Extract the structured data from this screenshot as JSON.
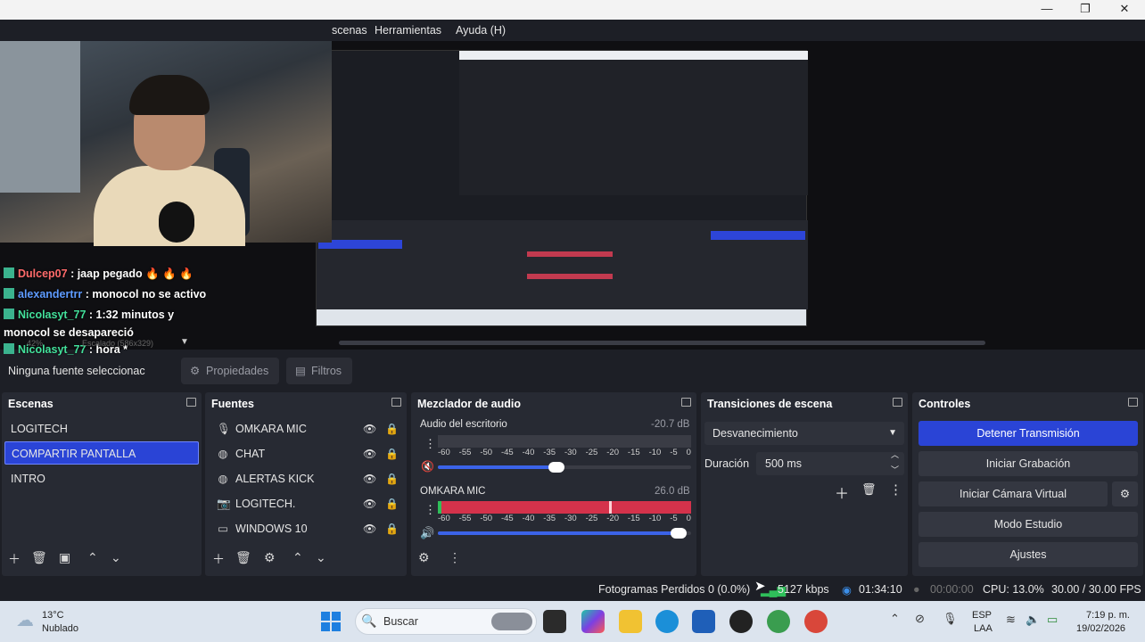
{
  "window": {
    "minimize": "—",
    "maximize": "❐",
    "close": "✕"
  },
  "menu": [
    "scenas",
    "Herramientas",
    "Ayuda (H)"
  ],
  "chat": [
    {
      "user": "Dulcep07",
      "text": ": jaap pegado 🔥 🔥 🔥"
    },
    {
      "user": "alexandertrr",
      "text": ": monocol no se activo"
    },
    {
      "user": "Nicolasyt_77",
      "text": ": 1:32 minutos y"
    },
    {
      "user": "",
      "text": "monocol se desapareció"
    },
    {
      "user": "Nicolasyt_77",
      "text": ": hora *"
    }
  ],
  "preview_overlay": {
    "zoom": "42%",
    "scale": "Escalado (586x329)"
  },
  "sourcebar": {
    "no_source": "Ninguna fuente seleccionac",
    "properties": "Propiedades",
    "filters": "Filtros"
  },
  "scenes": {
    "title": "Escenas",
    "items": [
      "LOGITECH",
      "COMPARTIR PANTALLA",
      "INTRO"
    ],
    "selected": "COMPARTIR PANTALLA"
  },
  "sources": {
    "title": "Fuentes",
    "items": [
      {
        "label": "OMKARA MIC",
        "icon": "microphone-icon"
      },
      {
        "label": "CHAT",
        "icon": "browser-icon"
      },
      {
        "label": "ALERTAS KICK",
        "icon": "browser-icon"
      },
      {
        "label": "LOGITECH.",
        "icon": "camera-icon"
      },
      {
        "label": "WINDOWS 10",
        "icon": "monitor-icon"
      }
    ]
  },
  "mixer": {
    "title": "Mezclador de audio",
    "channels": [
      {
        "name": "Audio del escritorio",
        "db": "-20.7 dB",
        "volume": 0.47,
        "muted": true
      },
      {
        "name": "OMKARA MIC",
        "db": "26.0 dB",
        "volume": 0.95,
        "muted": false
      }
    ],
    "ticks": [
      "-60",
      "-55",
      "-50",
      "-45",
      "-40",
      "-35",
      "-30",
      "-25",
      "-20",
      "-15",
      "-10",
      "-5",
      "0"
    ]
  },
  "transitions": {
    "title": "Transiciones de escena",
    "selected": "Desvanecimiento",
    "duration_label": "Duración",
    "duration_value": "500 ms"
  },
  "controls": {
    "title": "Controles",
    "buttons": [
      "Detener Transmisión",
      "Iniciar Grabación",
      "Iniciar Cámara Virtual",
      "Modo Estudio",
      "Ajustes"
    ]
  },
  "status": {
    "dropped": "Fotogramas Perdidos 0 (0.0%)",
    "bitrate": "5127 kbps",
    "stream_time": "01:34:10",
    "rec_time": "00:00:00",
    "cpu": "CPU: 13.0%",
    "fps": "30.00 / 30.00 FPS"
  },
  "taskbar": {
    "weather_temp": "13°C",
    "weather_desc": "Nublado",
    "search_placeholder": "Buscar",
    "lang_top": "ESP",
    "lang_bottom": "LAA",
    "time": "7:19 p. m.",
    "date": "19/02/2026"
  },
  "colors": {
    "accent": "#2a44d6",
    "meter_red": "#d4324b",
    "dock_bg": "#272a33"
  }
}
